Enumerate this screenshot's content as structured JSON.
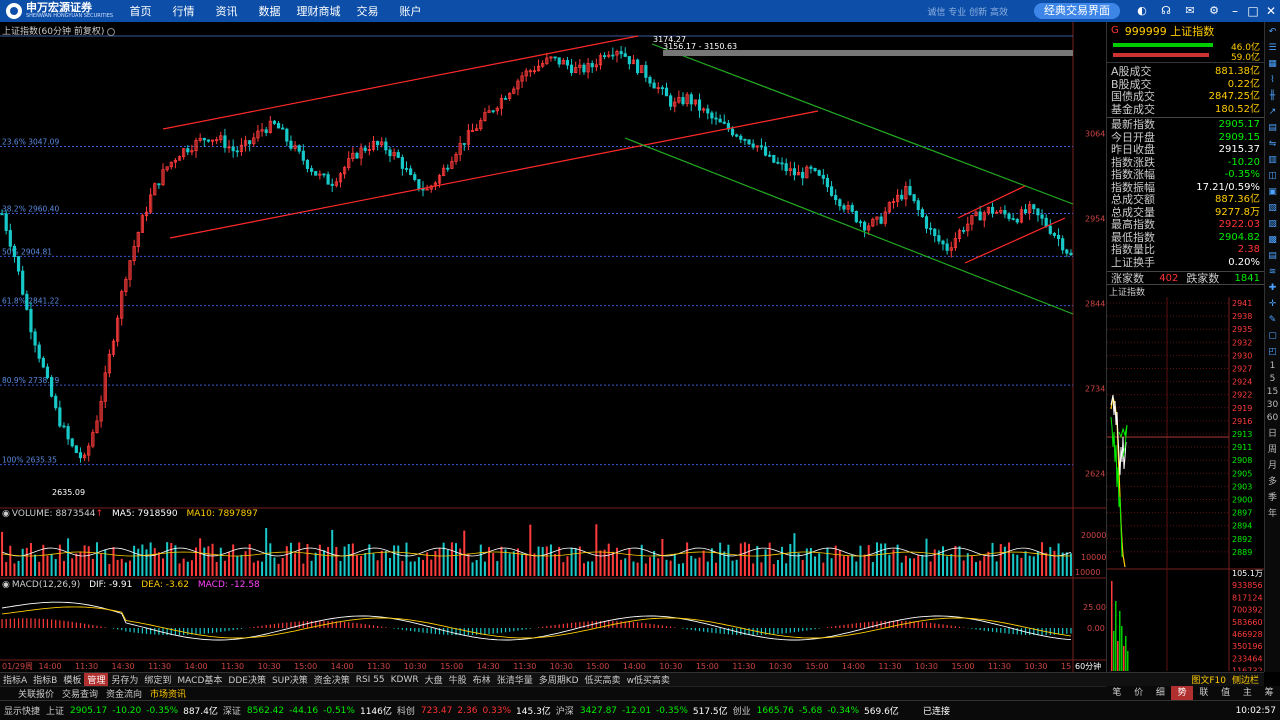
{
  "topbar": {
    "logo_text": "申万宏源证券",
    "logo_sub": "SHENWAN HONGYUAN SECURITIES",
    "nav": [
      "首页",
      "行情",
      "资讯",
      "数据",
      "理财商城",
      "交易",
      "账户"
    ],
    "ticker_text": "诚信 专业 创新 高效",
    "classic_button": "经典交易界面",
    "icons": [
      "theme-icon",
      "headset-icon",
      "mail-icon",
      "settings-icon"
    ],
    "window_controls": [
      "–",
      "□",
      "✕"
    ]
  },
  "chart": {
    "title": "上证指数(60分钟 前复权)",
    "fib_labels": [
      "23.6% 3047.09",
      "38.2% 2960.40",
      "50% 2904.81",
      "61.8% 2841.22",
      "80.9% 2738.29",
      "100% 2635.35"
    ],
    "price_axis": [
      "3064",
      "2954",
      "2844",
      "2734",
      "2624"
    ],
    "high_label": "3174.27",
    "range_label": "3156.17 - 3150.63",
    "low_label": "2635.09",
    "volume_title": "VOLUME: 8873544",
    "ma5": "MA5: 7918590",
    "ma10": "MA10: 7897897",
    "volume_axis": [
      "20000",
      "10000",
      "10000"
    ],
    "macd_title": "MACD(12,26,9)",
    "dif": "DIF: -9.91",
    "dea": "DEA: -3.62",
    "macd": "MACD: -12.58",
    "macd_axis": [
      "25.00",
      "0.00"
    ],
    "time_labels": [
      "01/29周",
      "14:00",
      "11:30",
      "14:30",
      "11:30",
      "14:00",
      "11:30",
      "10:30",
      "15:00",
      "14:00",
      "11:30",
      "10:30",
      "15:00",
      "14:30",
      "11:30",
      "10:30",
      "15:00",
      "14:00",
      "10:30",
      "15:00",
      "11:30",
      "10:30",
      "15:00",
      "14:00",
      "11:30",
      "10:30",
      "15:00",
      "11:30",
      "10:30",
      "15"
    ],
    "period": "60分钟"
  },
  "chart_data": {
    "type": "candlestick",
    "title": "上证指数(60分钟 前复权)",
    "ylim": [
      2600,
      3190
    ],
    "price_ticks": [
      3064,
      2954,
      2844,
      2734,
      2624
    ],
    "fib_levels": [
      {
        "pct": "23.6%",
        "value": 3047.09
      },
      {
        "pct": "38.2%",
        "value": 2960.4
      },
      {
        "pct": "50%",
        "value": 2904.81
      },
      {
        "pct": "61.8%",
        "value": 2841.22
      },
      {
        "pct": "80.9%",
        "value": 2738.29
      },
      {
        "pct": "100%",
        "value": 2635.35
      }
    ],
    "close_path": [
      2960,
      2900,
      2820,
      2760,
      2700,
      2660,
      2640,
      2700,
      2790,
      2880,
      2940,
      2990,
      3020,
      3040,
      3050,
      3060,
      3055,
      3040,
      3050,
      3070,
      3075,
      3050,
      3030,
      3010,
      3000,
      3020,
      3040,
      3050,
      3045,
      3030,
      3000,
      2990,
      3010,
      3040,
      3060,
      3080,
      3100,
      3120,
      3140,
      3150,
      3160,
      3155,
      3145,
      3150,
      3170,
      3174,
      3155,
      3140,
      3120,
      3100,
      3110,
      3095,
      3080,
      3070,
      3060,
      3050,
      3030,
      3020,
      3010,
      3015,
      3000,
      2980,
      2960,
      2945,
      2950,
      2975,
      2990,
      2960,
      2930,
      2915,
      2940,
      2955,
      2965,
      2960,
      2955,
      2965,
      2950,
      2930,
      2905
    ]
  },
  "panel": {
    "g": "G",
    "code": "999999 上证指数",
    "bar_values": [
      "46.0亿",
      "59.0亿"
    ],
    "stats1": [
      {
        "label": "A股成交",
        "value": "881.38亿"
      },
      {
        "label": "B股成交",
        "value": "0.22亿"
      },
      {
        "label": "国债成交",
        "value": "2847.25亿"
      },
      {
        "label": "基金成交",
        "value": "180.52亿"
      }
    ],
    "stats2": [
      {
        "label": "最新指数",
        "value": "2905.17",
        "color": "green"
      },
      {
        "label": "今日开盘",
        "value": "2909.15",
        "color": "green"
      },
      {
        "label": "昨日收盘",
        "value": "2915.37",
        "color": "white"
      },
      {
        "label": "指数涨跌",
        "value": "-10.20",
        "color": "green"
      },
      {
        "label": "指数涨幅",
        "value": "-0.35%",
        "color": "green"
      },
      {
        "label": "指数振幅",
        "value": "17.21/0.59%",
        "color": "white"
      },
      {
        "label": "总成交额",
        "value": "887.36亿",
        "color": ""
      },
      {
        "label": "总成交量",
        "value": "9277.8万",
        "color": ""
      },
      {
        "label": "最高指数",
        "value": "2922.03",
        "color": "red"
      },
      {
        "label": "最低指数",
        "value": "2904.82",
        "color": "green"
      },
      {
        "label": "指数量比",
        "value": "2.38",
        "color": "red"
      },
      {
        "label": "上证换手",
        "value": "0.20%",
        "color": "white"
      }
    ],
    "up_label": "涨家数",
    "up_value": "402",
    "down_label": "跌家数",
    "down_value": "1841",
    "mini_title": "上证指数",
    "mini_axis": [
      "2941",
      "2938",
      "2935",
      "2932",
      "2930",
      "2927",
      "2924",
      "2922",
      "2919",
      "2916",
      "2913",
      "2911",
      "2908",
      "2905",
      "2903",
      "2900",
      "2897",
      "2894",
      "2892",
      "2889"
    ],
    "mini_vol_axis": [
      "105.1万",
      "933856",
      "817124",
      "700392",
      "583660",
      "466928",
      "350196",
      "233464",
      "116732"
    ],
    "tabs": [
      "笔",
      "价",
      "细",
      "势",
      "联",
      "值",
      "主",
      "筹"
    ],
    "active_tab": "势"
  },
  "sidebar_chars": [
    "1",
    "5",
    "15",
    "30",
    "60",
    "日",
    "周",
    "月",
    "多",
    "季",
    "年"
  ],
  "tabs_row": [
    "指标A",
    "指标B",
    "模板",
    "管理",
    "另存为",
    "绑定到",
    "MACD基本",
    "DDE决策",
    "SUP决策",
    "资金决策",
    "RSI 55",
    "KDWR",
    "大盘",
    "牛股",
    "布林",
    "张清华量",
    "多周期KD",
    "低买高卖",
    "w低买高卖"
  ],
  "tabs_row_right": [
    "图文F10",
    "侧边栏"
  ],
  "bottom_tabs": [
    "关联报价",
    "交易查询",
    "资金流向",
    "市场资讯"
  ],
  "status": {
    "quick": "显示快捷",
    "sh_label": "上证",
    "sh_price": "2905.17",
    "sh_chg": "-10.20",
    "sh_pct": "-0.35%",
    "sh_amt": "887.4亿",
    "sz_label": "深证",
    "sz_price": "8562.42",
    "sz_chg": "-44.16",
    "sz_pct": "-0.51%",
    "sz_amt": "1146亿",
    "kc_label": "科创",
    "kc_price": "723.47",
    "kc_chg": "2.36",
    "kc_pct": "0.33%",
    "kc_amt": "145.3亿",
    "hs_label": "沪深",
    "hs_price": "3427.87",
    "hs_chg": "-12.01",
    "hs_pct": "-0.35%",
    "hs_amt": "517.5亿",
    "cy_label": "创业",
    "cy_price": "1665.76",
    "cy_chg": "-5.68",
    "cy_pct": "-0.34%",
    "cy_amt": "569.6亿",
    "conn": "已连接",
    "time": "10:02:57"
  }
}
